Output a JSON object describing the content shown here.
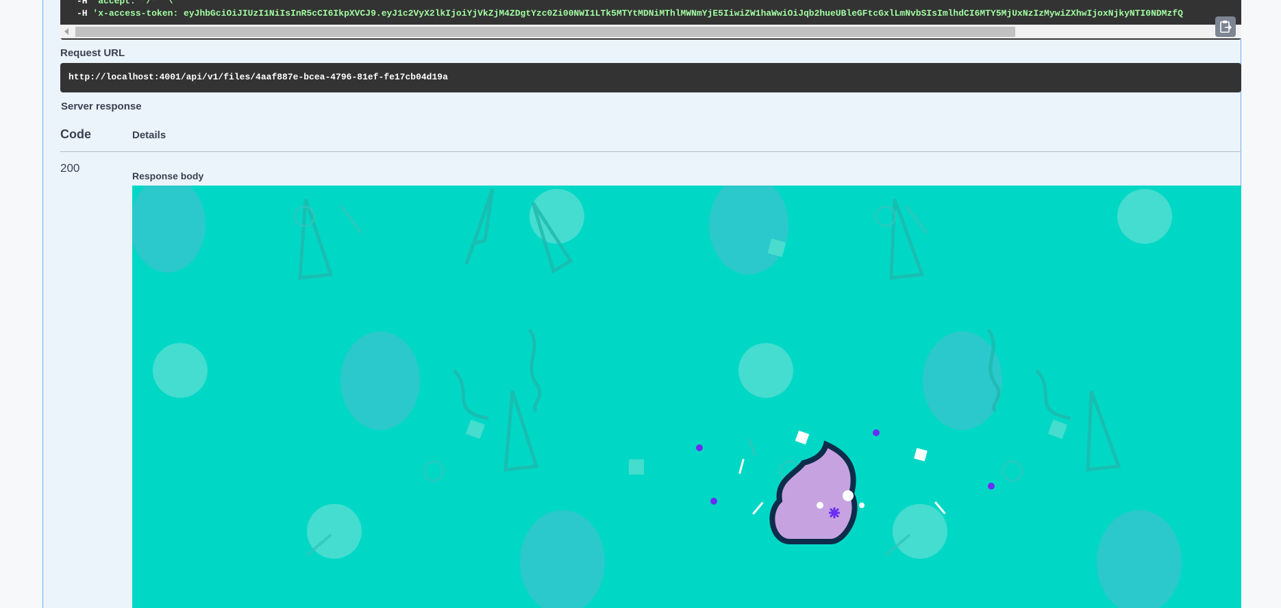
{
  "curl": {
    "line1_flag": "-H",
    "line1_value": "'accept: */*' \\",
    "line2_flag": "-H",
    "line2_value": "'x-access-token: eyJhbGciOiJIUzI1NiIsInR5cCI6IkpXVCJ9.eyJ1c2VyX2lkIjoiYjVkZjM4ZDgtYzc0Zi00NWI1LTk5MTYtMDNiMThlMWNmYjE5IiwiZW1haWwiOiJqb2hueUBleGFtcGxlLmNvbSIsImlhdCI6MTY5MjUxNzIzMywiZXhwIjoxNjkyNTI0NDMzfQ"
  },
  "request_url": {
    "label": "Request URL",
    "value": "http://localhost:4001/api/v1/files/4aaf887e-bcea-4796-81ef-fe17cb04d19a"
  },
  "server_response": {
    "label": "Server response",
    "col_code": "Code",
    "col_details": "Details",
    "code": "200",
    "body_label": "Response body"
  },
  "icons": {
    "copy": "clipboard-copy-icon",
    "scroll_left": "arrow-left-icon"
  },
  "colors": {
    "accent": "#61affe",
    "code_bg": "#333333",
    "image_bg": "#00d8c5",
    "token_text": "#a2fca2"
  }
}
